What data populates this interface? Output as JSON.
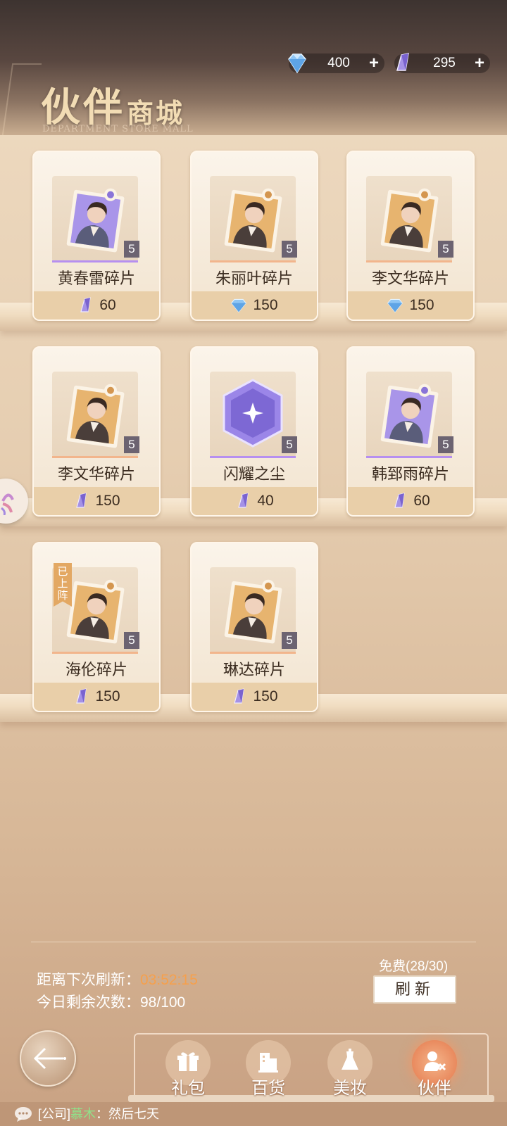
{
  "header": {
    "title_main": "伙伴",
    "title_sub": "商城",
    "title_en": "DEPARTMENT STORE MALL"
  },
  "currencies": [
    {
      "icon": "diamond-icon",
      "value": "400",
      "plus": "+"
    },
    {
      "icon": "crystal-shard-icon",
      "value": "295",
      "plus": "+"
    }
  ],
  "shop_items": [
    {
      "name": "黄春雷碎片",
      "count": "5",
      "price": "60",
      "currency": "crystal",
      "rarity_color": "#b68ff0",
      "art": "purple-puzzle"
    },
    {
      "name": "朱丽叶碎片",
      "count": "5",
      "price": "150",
      "currency": "diamond",
      "rarity_color": "#f2b58c",
      "art": "gold-puzzle"
    },
    {
      "name": "李文华碎片",
      "count": "5",
      "price": "150",
      "currency": "diamond",
      "rarity_color": "#f2b58c",
      "art": "gold-puzzle"
    },
    {
      "name": "李文华碎片",
      "count": "5",
      "price": "150",
      "currency": "crystal",
      "rarity_color": "#f2b58c",
      "art": "gold-puzzle"
    },
    {
      "name": "闪耀之尘",
      "count": "5",
      "price": "40",
      "currency": "crystal",
      "rarity_color": "#b68ff0",
      "art": "purple-hexagon"
    },
    {
      "name": "韩郅雨碎片",
      "count": "5",
      "price": "60",
      "currency": "crystal",
      "rarity_color": "#b68ff0",
      "art": "purple-puzzle"
    },
    {
      "name": "海伦碎片",
      "count": "5",
      "price": "150",
      "currency": "crystal",
      "rarity_color": "#f2b58c",
      "art": "gold-puzzle",
      "badge": "已上阵"
    },
    {
      "name": "琳达碎片",
      "count": "5",
      "price": "150",
      "currency": "crystal",
      "rarity_color": "#f2b58c",
      "art": "gold-puzzle"
    }
  ],
  "refresh": {
    "next_label": "距离下次刷新：",
    "timer": "03:52:15",
    "remaining_label": "今日剩余次数：",
    "remaining_value": "98/100",
    "free_label": "免费(28/30)",
    "button_label": "刷新"
  },
  "nav": [
    {
      "label": "礼包",
      "icon": "gift-icon",
      "active": false
    },
    {
      "label": "百货",
      "icon": "store-icon",
      "active": false
    },
    {
      "label": "美妆",
      "icon": "dress-icon",
      "active": false
    },
    {
      "label": "伙伴",
      "icon": "partner-icon",
      "active": true
    }
  ],
  "chat": {
    "channel": "[公司]",
    "sender": "慕木",
    "separator": "：",
    "message": "然后七天"
  }
}
